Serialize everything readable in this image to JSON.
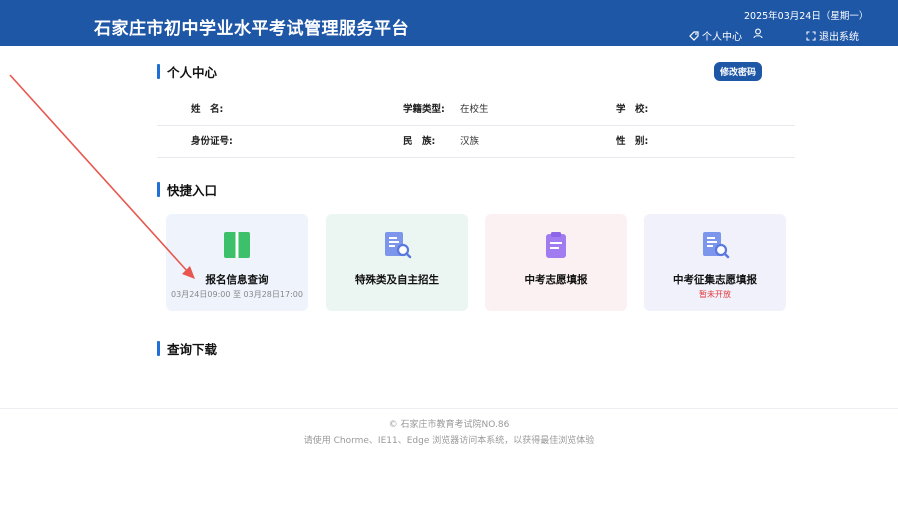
{
  "header": {
    "title": "石家庄市初中学业水平考试管理服务平台",
    "date": "2025年03月24日（星期一）",
    "nav": {
      "profile": "个人中心",
      "logout": "退出系统"
    }
  },
  "personal": {
    "section_title": "个人中心",
    "change_password": "修改密码",
    "fields": {
      "name_label": "姓　名:",
      "name_value": "",
      "status_label": "学籍类型:",
      "status_value": "在校生",
      "school_label": "学　校:",
      "school_value": "",
      "id_label": "身份证号:",
      "id_value": "",
      "ethnic_label": "民　族:",
      "ethnic_value": "汉族",
      "gender_label": "性　别:",
      "gender_value": ""
    }
  },
  "quick": {
    "section_title": "快捷入口",
    "cards": [
      {
        "name": "报名信息查询",
        "sub": "03月24日09:00 至 03月28日17:00",
        "icon": "book-icon",
        "color": "#3cc06a"
      },
      {
        "name": "特殊类及自主招生",
        "sub": "",
        "icon": "document-search-icon",
        "color": "#6f8fe8"
      },
      {
        "name": "中考志愿填报",
        "sub": "",
        "icon": "clipboard-icon",
        "color": "#a07cf0"
      },
      {
        "name": "中考征集志愿填报",
        "sub": "暂未开放",
        "icon": "document-search-icon",
        "color": "#6f8fe8"
      }
    ]
  },
  "download": {
    "section_title": "查询下载"
  },
  "footer": {
    "copyright": "© 石家庄市教育考试院NO.86",
    "browser_tip": "请使用 Chorme、IE11、Edge 浏览器访问本系统，以获得最佳浏览体验"
  },
  "colors": {
    "header_bg": "#1f57a7",
    "accent": "#1f6fd6",
    "warning": "#e23b3b",
    "annotation_arrow": "#e8574f"
  }
}
